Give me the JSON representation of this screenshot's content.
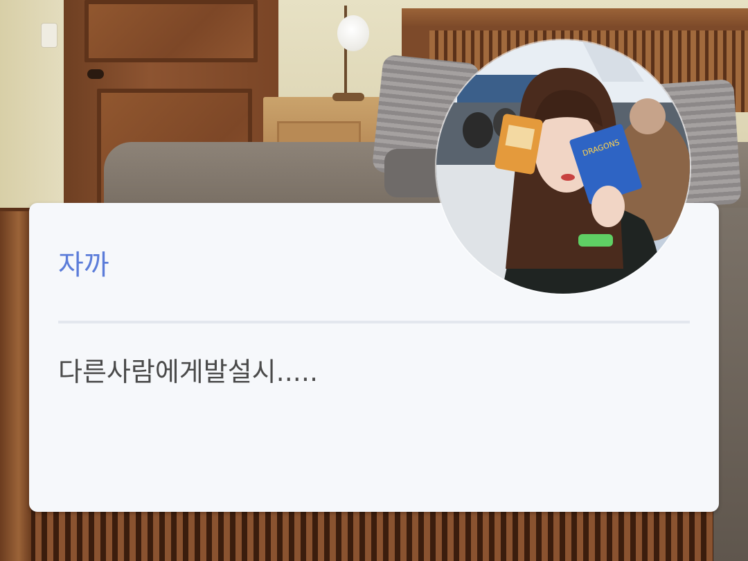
{
  "dialog": {
    "name": "자까",
    "message": "다른사람에게발설시....."
  },
  "avatar": {
    "icon": "profile-photo",
    "packet_left_text": "",
    "packet_right_text": "DRAGONS"
  },
  "colors": {
    "name_accent": "#5b7cd9",
    "card_background": "#f6f8fb",
    "divider": "#e3e7ee",
    "message_text": "#4a4a4a"
  }
}
